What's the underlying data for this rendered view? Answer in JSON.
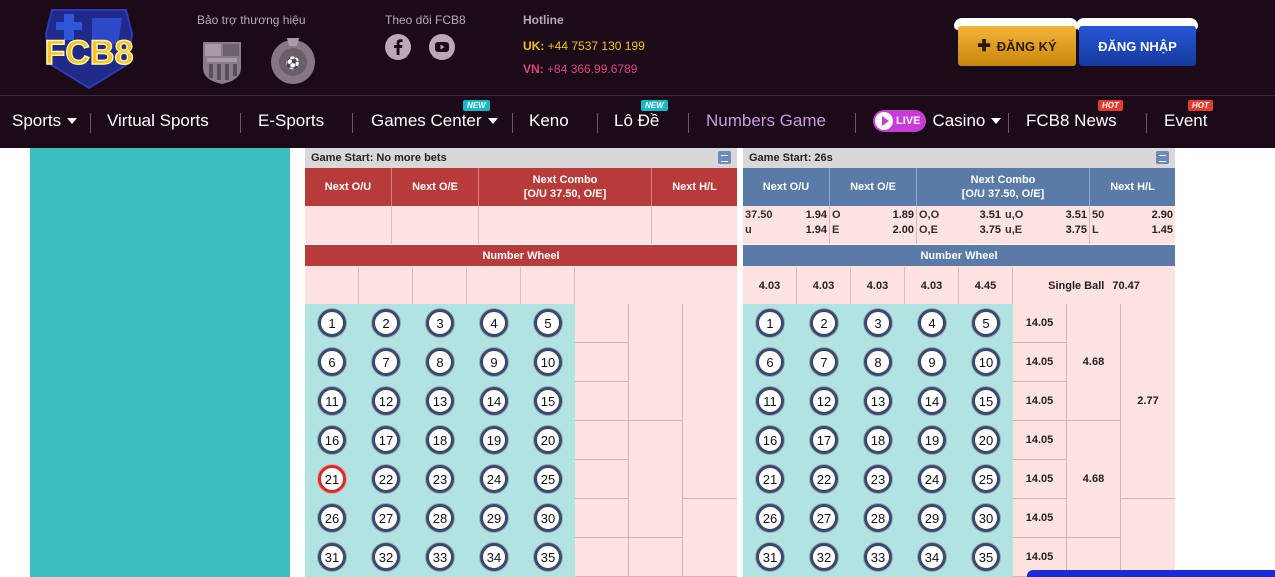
{
  "header": {
    "logo_text": "FCB8",
    "sponsor_label": "Bảo trợ thương hiệu",
    "follow_label": "Theo dõi FCB8",
    "hotline_label": "Hotline",
    "hotline_uk_prefix": "UK:",
    "hotline_uk_number": "+44 7537 130 199",
    "hotline_vn_prefix": "VN:",
    "hotline_vn_number": "+84 366.99.6789",
    "register_label": "ĐĂNG KÝ",
    "login_label": "ĐĂNG NHẬP",
    "colors": {
      "bg": "#1b0b19",
      "uk": "#f0c020",
      "vn": "#e0457a",
      "register": "#e0a020",
      "login": "#1f4ec0"
    }
  },
  "nav": {
    "items": [
      {
        "label": "Sports",
        "dropdown": true
      },
      {
        "label": "Virtual Sports"
      },
      {
        "label": "E-Sports"
      },
      {
        "label": "Games Center",
        "dropdown": true,
        "badge": "NEW"
      },
      {
        "label": "Keno"
      },
      {
        "label": "Lô Đề",
        "badge": "NEW"
      },
      {
        "label": "Numbers Game",
        "active": true
      },
      {
        "label": "Casino",
        "dropdown": true,
        "live_badge": "LIVE"
      },
      {
        "label": "FCB8 News",
        "badge": "HOT"
      },
      {
        "label": "Event",
        "badge": "HOT"
      }
    ]
  },
  "left_board": {
    "game_start": "Game Start: No more bets",
    "headers": [
      "Next O/U",
      "Next O/E",
      "Next Combo\n[O/U 37.50, O/E]",
      "Next H/L"
    ],
    "wheel_title": "Number Wheel",
    "highlight_ball": 21
  },
  "right_board": {
    "game_start": "Game Start: 26s",
    "headers": [
      "Next O/U",
      "Next O/E",
      "Next Combo\n[O/U 37.50, O/E]",
      "Next H/L"
    ],
    "odds": {
      "ou": [
        [
          "37.50",
          "1.94"
        ],
        [
          "u",
          "1.94"
        ]
      ],
      "oe": [
        [
          "O",
          "1.89"
        ],
        [
          "E",
          "2.00"
        ]
      ],
      "combo": [
        [
          "O,O",
          "3.51"
        ],
        [
          "u,O",
          "3.51"
        ],
        [
          "O,E",
          "3.75"
        ],
        [
          "u,E",
          "3.75"
        ]
      ],
      "hl": [
        [
          "50",
          "2.90"
        ],
        [
          "L",
          "1.45"
        ]
      ]
    },
    "wheel_title": "Number Wheel",
    "wheel_odds": [
      "4.03",
      "4.03",
      "4.03",
      "4.03",
      "4.45"
    ],
    "single_ball_label": "Single Ball",
    "single_ball_value": "70.47",
    "row_odds": [
      "14.05",
      "14.05",
      "14.05",
      "14.05",
      "14.05",
      "14.05",
      "14.05"
    ],
    "group_odds": [
      "4.68",
      "4.68"
    ],
    "big_group_odds": "2.77"
  },
  "balls": [
    1,
    2,
    3,
    4,
    5,
    6,
    7,
    8,
    9,
    10,
    11,
    12,
    13,
    14,
    15,
    16,
    17,
    18,
    19,
    20,
    21,
    22,
    23,
    24,
    25,
    26,
    27,
    28,
    29,
    30,
    31,
    32,
    33,
    34,
    35
  ]
}
